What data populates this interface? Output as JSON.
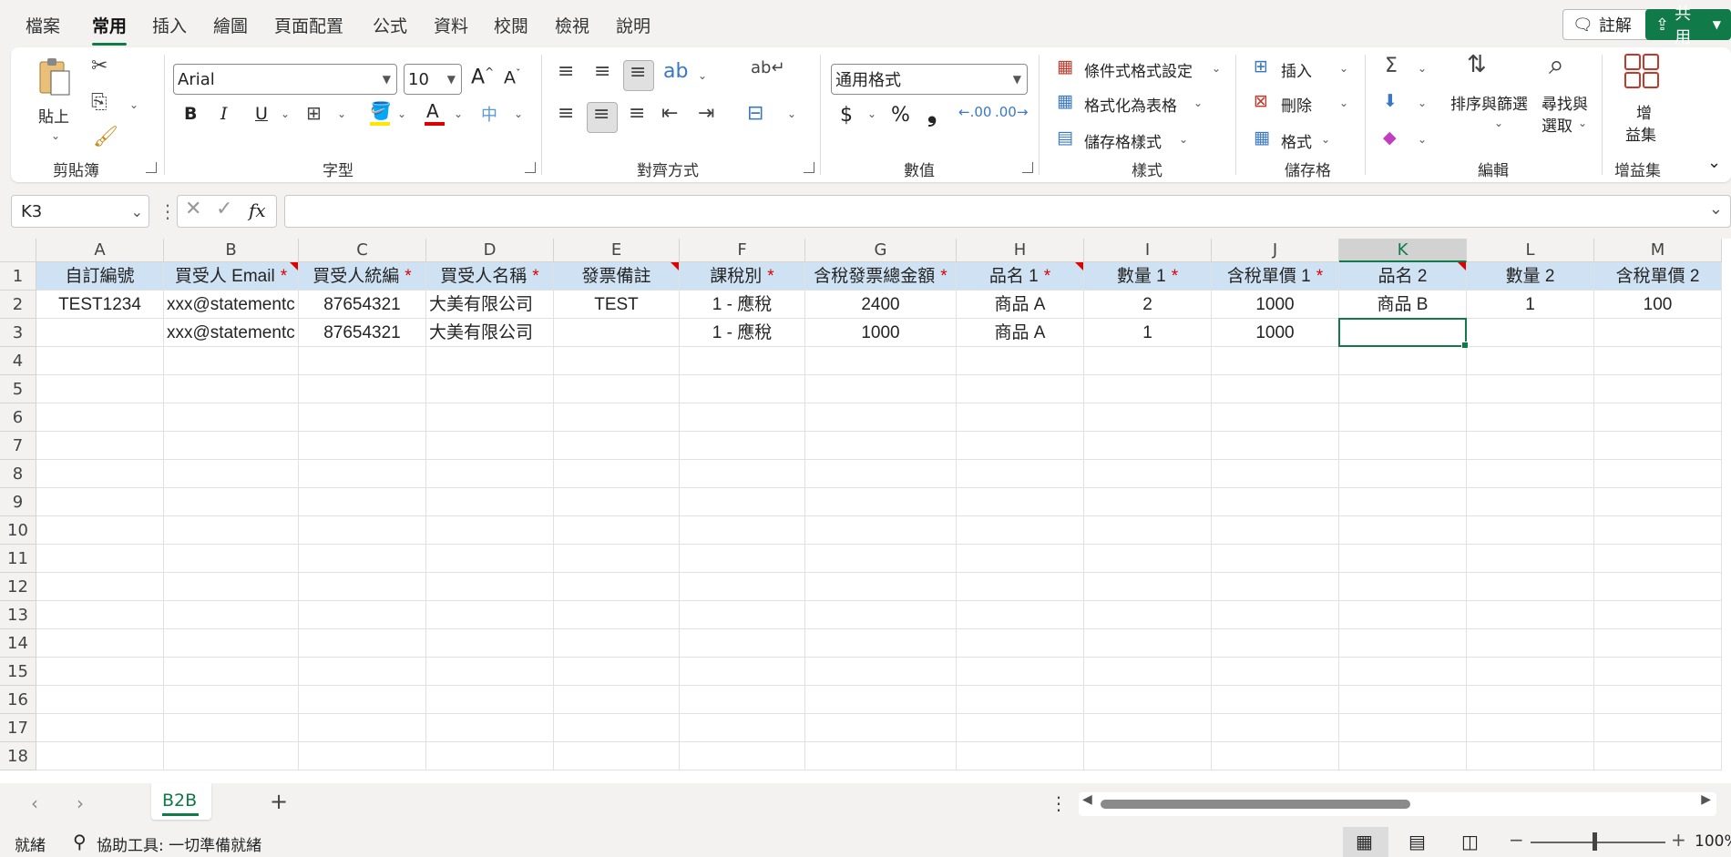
{
  "menu": {
    "tabs": [
      "檔案",
      "常用",
      "插入",
      "繪圖",
      "頁面配置",
      "公式",
      "資料",
      "校閱",
      "檢視",
      "說明"
    ],
    "comments_label": "註解",
    "share_label": "共用"
  },
  "ribbon": {
    "clipboard": {
      "paste": "貼上",
      "label": "剪貼簿"
    },
    "font": {
      "name": "Arial",
      "size": "10",
      "label": "字型",
      "bold": "B",
      "italic": "I",
      "underline": "U"
    },
    "alignment": {
      "label": "對齊方式"
    },
    "number": {
      "format": "通用格式",
      "label": "數值",
      "currency": "$",
      "percent": "%",
      "comma": "❟"
    },
    "styles": {
      "conditional": "條件式格式設定",
      "table": "格式化為表格",
      "cell_styles": "儲存格樣式",
      "label": "樣式"
    },
    "cells": {
      "insert": "插入",
      "delete": "刪除",
      "format": "格式",
      "label": "儲存格"
    },
    "editing": {
      "sort": "排序與篩選",
      "find_1": "尋找與",
      "find_2": "選取",
      "label": "編輯"
    },
    "addins": {
      "btn_1": "增",
      "btn_2": "益集",
      "label": "增益集"
    }
  },
  "formula_bar": {
    "name_box": "K3",
    "fx": "fx",
    "value": ""
  },
  "grid": {
    "columns": [
      "A",
      "B",
      "C",
      "D",
      "E",
      "F",
      "G",
      "H",
      "I",
      "J",
      "K",
      "L",
      "M"
    ],
    "selected_column": "K",
    "rows": [
      "1",
      "2",
      "3",
      "4",
      "5",
      "6",
      "7",
      "8",
      "9",
      "10",
      "11",
      "12",
      "13",
      "14",
      "15",
      "16",
      "17",
      "18"
    ],
    "header": [
      {
        "text": "自訂編號",
        "req": "",
        "tri": false
      },
      {
        "text": "買受人 Email",
        "req": "*",
        "tri": true
      },
      {
        "text": "買受人統編",
        "req": "*",
        "tri": false
      },
      {
        "text": "買受人名稱",
        "req": "*",
        "tri": false
      },
      {
        "text": "發票備註",
        "req": "",
        "tri": true
      },
      {
        "text": "課稅別",
        "req": "*",
        "tri": false
      },
      {
        "text": "含稅發票總金額",
        "req": "*",
        "tri": false
      },
      {
        "text": "品名 1",
        "req": "*",
        "tri": true
      },
      {
        "text": "數量 1",
        "req": "*",
        "tri": false
      },
      {
        "text": "含稅單價 1",
        "req": "*",
        "tri": false
      },
      {
        "text": "品名 2",
        "req": "",
        "tri": true
      },
      {
        "text": "數量 2",
        "req": "",
        "tri": false
      },
      {
        "text": "含稅單價 2",
        "req": "",
        "tri": false
      }
    ],
    "data": [
      [
        "TEST1234",
        "xxx@statementc",
        "87654321",
        "大美有限公司",
        "TEST",
        "1 - 應稅",
        "2400",
        "商品 A",
        "2",
        "1000",
        "商品 B",
        "1",
        "100"
      ],
      [
        "",
        "xxx@statementc",
        "87654321",
        "大美有限公司",
        "",
        "1 - 應稅",
        "1000",
        "商品 A",
        "1",
        "1000",
        "",
        "",
        ""
      ]
    ]
  },
  "sheet_tabs": {
    "active": "B2B",
    "add": "+"
  },
  "status": {
    "ready": "就緒",
    "accessibility": "協助工具: 一切準備就緒",
    "zoom": "100%"
  }
}
